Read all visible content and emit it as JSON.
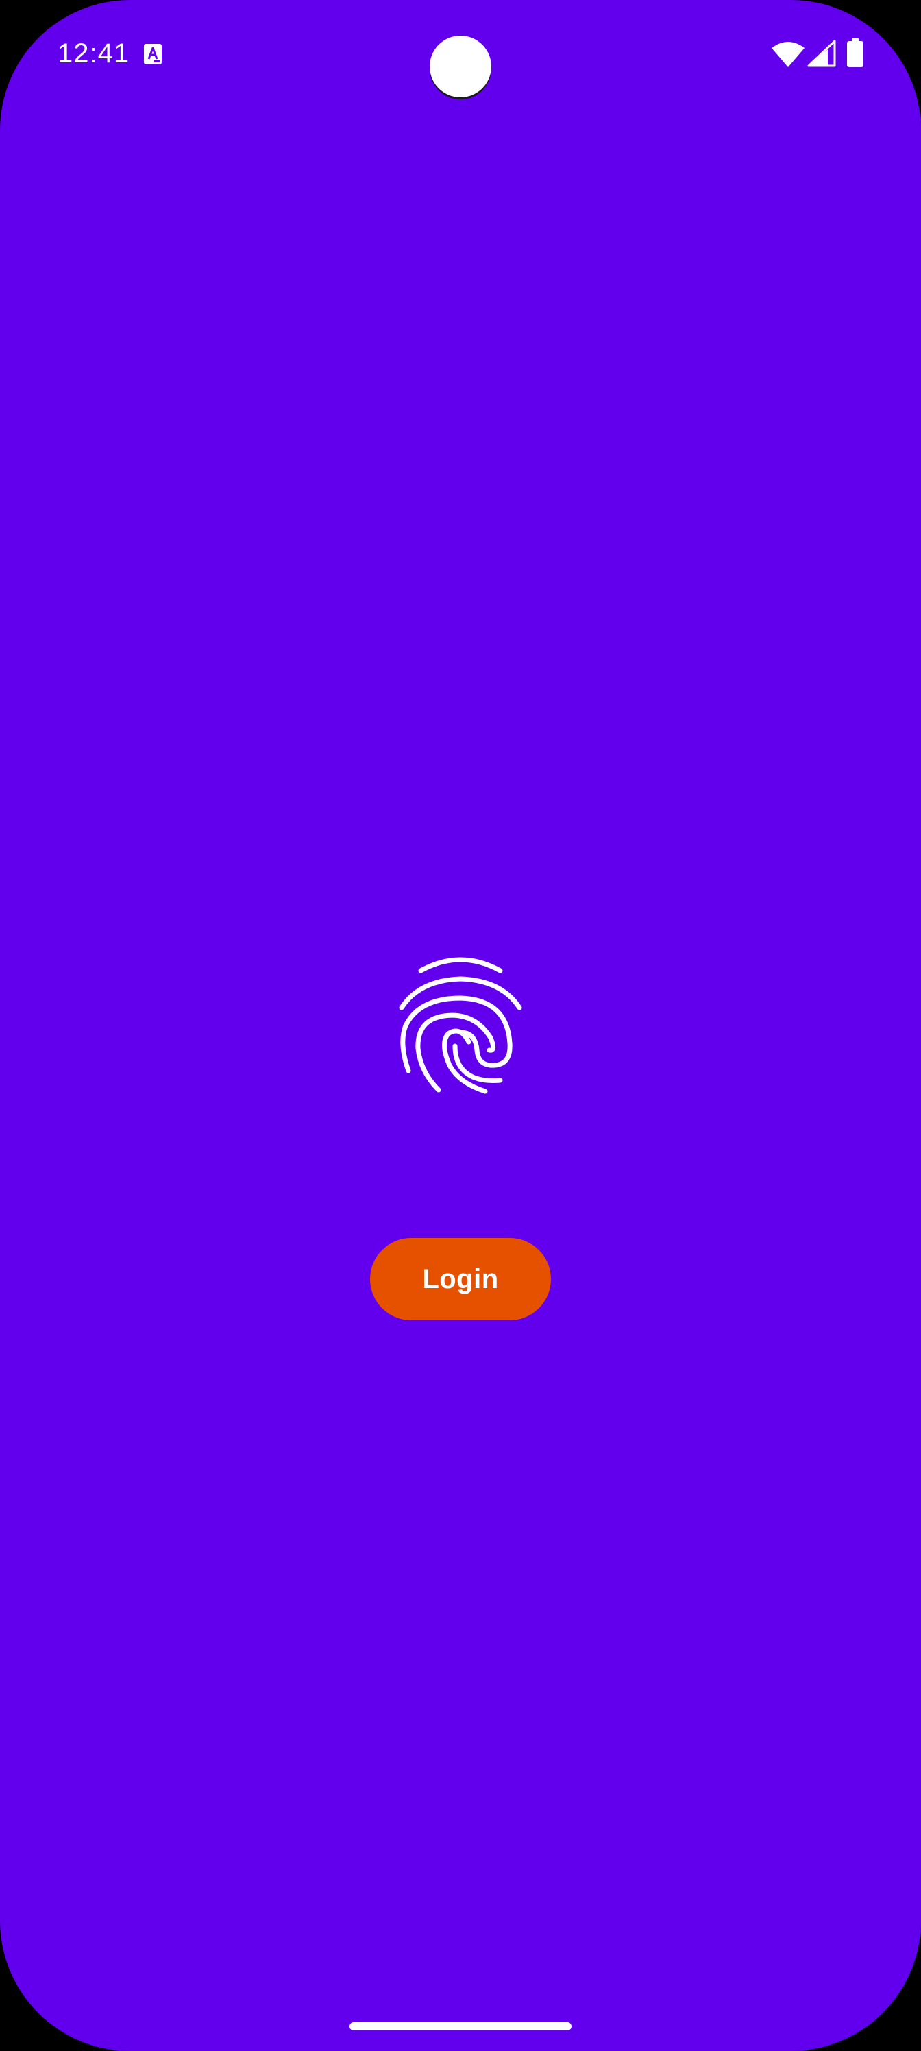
{
  "status_bar": {
    "time": "12:41",
    "icons": [
      "text-a-icon",
      "wifi-icon",
      "signal-icon",
      "battery-icon"
    ]
  },
  "main": {
    "fingerprint_icon": "fingerprint-icon",
    "login_label": "Login"
  },
  "colors": {
    "background": "#6200EE",
    "login_button": "#E65100",
    "foreground": "#FFFFFF"
  }
}
